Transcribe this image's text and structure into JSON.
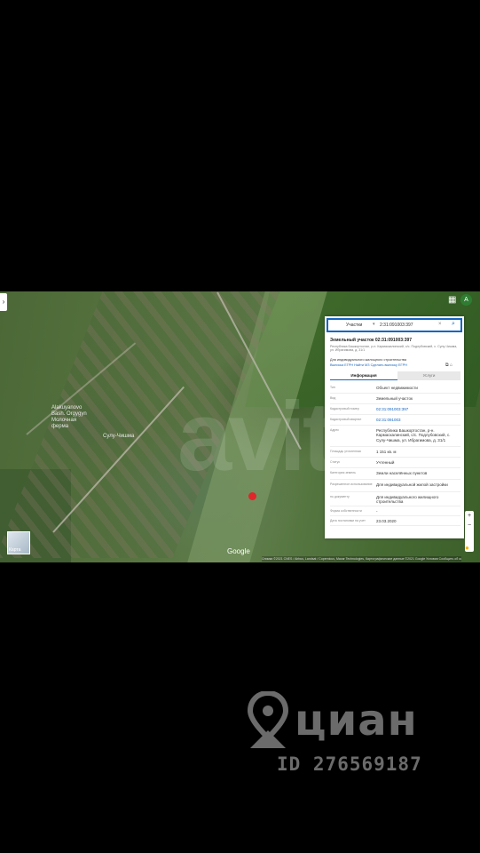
{
  "map": {
    "watermark": "avito",
    "labels": [
      {
        "text": "Alakuyanovo\nBash. Orgygyn\nМолочная\nферма"
      },
      {
        "text": "Сулу-Чишма"
      }
    ],
    "google_logo": "Google",
    "attribution": "Снимки ©2021 CNES / Airbus, Landsat / Copernicus, Maxar Technologies, Картографические данные ©2021 Google   Условия   Сообщить об ошибке   Feedback geo",
    "layer_button_label": "Карта",
    "grid_icon": "grid-icon",
    "user_initial": "А",
    "colors": {
      "marker": "#e0262a",
      "accent": "#1565c0"
    }
  },
  "panel": {
    "search": {
      "type_label": "Участки",
      "query": "2:31:091003:397"
    },
    "title": "Земельный участок 02:31:091003:397",
    "address_line": "Республика Башкортостан, р-н. Кармаскалинский, с/с. Подлубовский, с. Сулу-Чишма, ул. Ибрагимова, д. 31/1",
    "use_line": "Для индивидуального жилищного строительства",
    "links": "Выписка ЕГРН   Найти МЗ   Сделать выписку ЕГРН",
    "tabs": {
      "info": "Информация",
      "services": "Услуги"
    },
    "rows": [
      {
        "k": "Тип",
        "v": "Объект недвижимости"
      },
      {
        "k": "Вид",
        "v": "Земельный участок"
      },
      {
        "k": "Кадастровый номер",
        "v": "02:31:091003:397",
        "link": true
      },
      {
        "k": "Кадастровый квартал",
        "v": "02:31:091003",
        "link": true
      },
      {
        "k": "Адрес",
        "v": "Республика Башкортостан, р-н. Кармаскалинский, с/с. Подлубовский, с. Сулу-Чишма, ул. Ибрагимова, д. 31/1"
      },
      {
        "k": "Площадь уточненная",
        "v": "1 151 кв. м"
      },
      {
        "k": "Статус",
        "v": "Учтенный"
      },
      {
        "k": "Категория земель",
        "v": "Земли населённых пунктов"
      },
      {
        "k": "Разрешенное использование",
        "v": "Для индивидуальной жилой застройки"
      },
      {
        "k": "по документу",
        "v": "Для индивидуального жилищного строительства"
      },
      {
        "k": "Форма собственности",
        "v": "-"
      },
      {
        "k": "Дата постановки на учет",
        "v": "23.03.2020"
      }
    ]
  },
  "brand": {
    "name": "циан",
    "listing_id": "ID 276569187"
  }
}
